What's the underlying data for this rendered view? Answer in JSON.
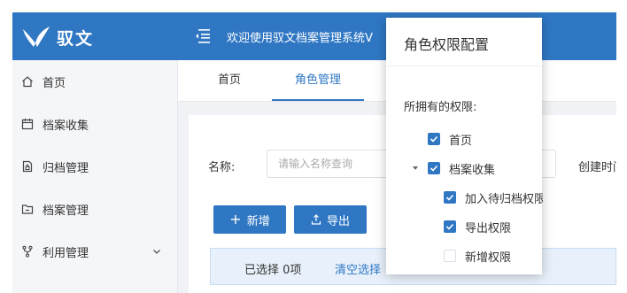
{
  "header": {
    "logo_text": "驭文",
    "welcome": "欢迎使用驭文档案管理系统V"
  },
  "sidebar": {
    "items": [
      {
        "label": "首页",
        "icon": "home-icon"
      },
      {
        "label": "档案收集",
        "icon": "calendar-icon"
      },
      {
        "label": "归档管理",
        "icon": "file-lock-icon"
      },
      {
        "label": "档案管理",
        "icon": "folder-icon"
      },
      {
        "label": "利用管理",
        "icon": "branch-icon"
      }
    ]
  },
  "tabs": [
    {
      "label": "首页"
    },
    {
      "label": "角色管理"
    }
  ],
  "search": {
    "name_label": "名称:",
    "name_placeholder": "请输入名称查询",
    "created_label": "创建时间"
  },
  "actions": {
    "add_label": "新增",
    "export_label": "导出"
  },
  "selection": {
    "selected_text": "已选择 0项",
    "clear_text": "清空选择"
  },
  "modal": {
    "title": "角色权限配置",
    "subtitle": "所拥有的权限:",
    "tree": [
      {
        "label": "首页",
        "checked": true
      },
      {
        "label": "档案收集",
        "checked": true,
        "expanded": true
      },
      {
        "label": "加入待归档权限",
        "checked": true
      },
      {
        "label": "导出权限",
        "checked": true
      },
      {
        "label": "新增权限",
        "checked": false
      }
    ]
  },
  "colors": {
    "brand": "#2f77c3",
    "checkbox_on": "#2f77c3"
  }
}
